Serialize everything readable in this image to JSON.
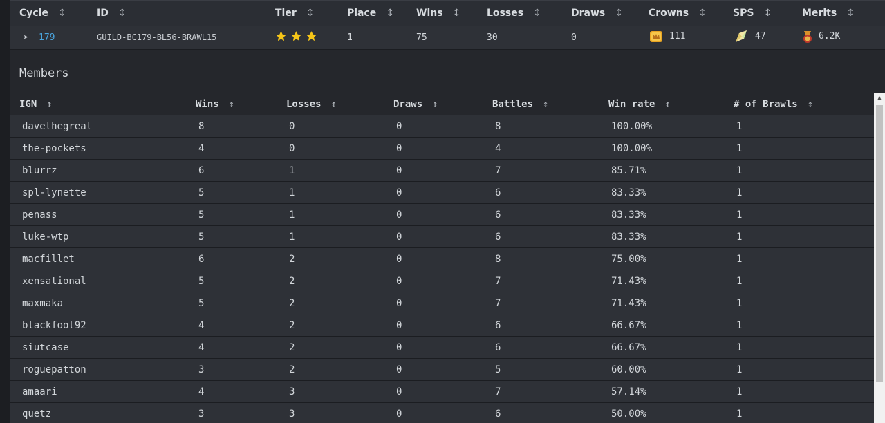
{
  "brawl": {
    "headers": [
      "Cycle",
      "ID",
      "Tier",
      "Place",
      "Wins",
      "Losses",
      "Draws",
      "Crowns",
      "SPS",
      "Merits"
    ],
    "sort_glyph": "↕",
    "row": {
      "cycle": "179",
      "id": "GUILD-BC179-BL56-BRAWL15",
      "tier_stars": 3,
      "place": "1",
      "wins": "75",
      "losses": "30",
      "draws": "0",
      "crowns": "111",
      "sps": "47",
      "merits": "6.2K"
    },
    "expand_icon": "chevron-right-icon"
  },
  "members": {
    "title": "Members",
    "headers": [
      "IGN",
      "Wins",
      "Losses",
      "Draws",
      "Battles",
      "Win rate",
      "# of Brawls"
    ],
    "rows": [
      [
        "davethegreat",
        "8",
        "0",
        "0",
        "8",
        "100.00%",
        "1"
      ],
      [
        "the-pockets",
        "4",
        "0",
        "0",
        "4",
        "100.00%",
        "1"
      ],
      [
        "blurrz",
        "6",
        "1",
        "0",
        "7",
        "85.71%",
        "1"
      ],
      [
        "spl-lynette",
        "5",
        "1",
        "0",
        "6",
        "83.33%",
        "1"
      ],
      [
        "penass",
        "5",
        "1",
        "0",
        "6",
        "83.33%",
        "1"
      ],
      [
        "luke-wtp",
        "5",
        "1",
        "0",
        "6",
        "83.33%",
        "1"
      ],
      [
        "macfillet",
        "6",
        "2",
        "0",
        "8",
        "75.00%",
        "1"
      ],
      [
        "xensational",
        "5",
        "2",
        "0",
        "7",
        "71.43%",
        "1"
      ],
      [
        "maxmaka",
        "5",
        "2",
        "0",
        "7",
        "71.43%",
        "1"
      ],
      [
        "blackfoot92",
        "4",
        "2",
        "0",
        "6",
        "66.67%",
        "1"
      ],
      [
        "siutcase",
        "4",
        "2",
        "0",
        "6",
        "66.67%",
        "1"
      ],
      [
        "roguepatton",
        "3",
        "2",
        "0",
        "5",
        "60.00%",
        "1"
      ],
      [
        "amaari",
        "4",
        "3",
        "0",
        "7",
        "57.14%",
        "1"
      ],
      [
        "quetz",
        "3",
        "3",
        "0",
        "6",
        "50.00%",
        "1"
      ]
    ]
  },
  "colors": {
    "accent_link": "#4aa6e0",
    "star": "#f5c518",
    "background": "#25272c",
    "row": "#2e3137"
  }
}
